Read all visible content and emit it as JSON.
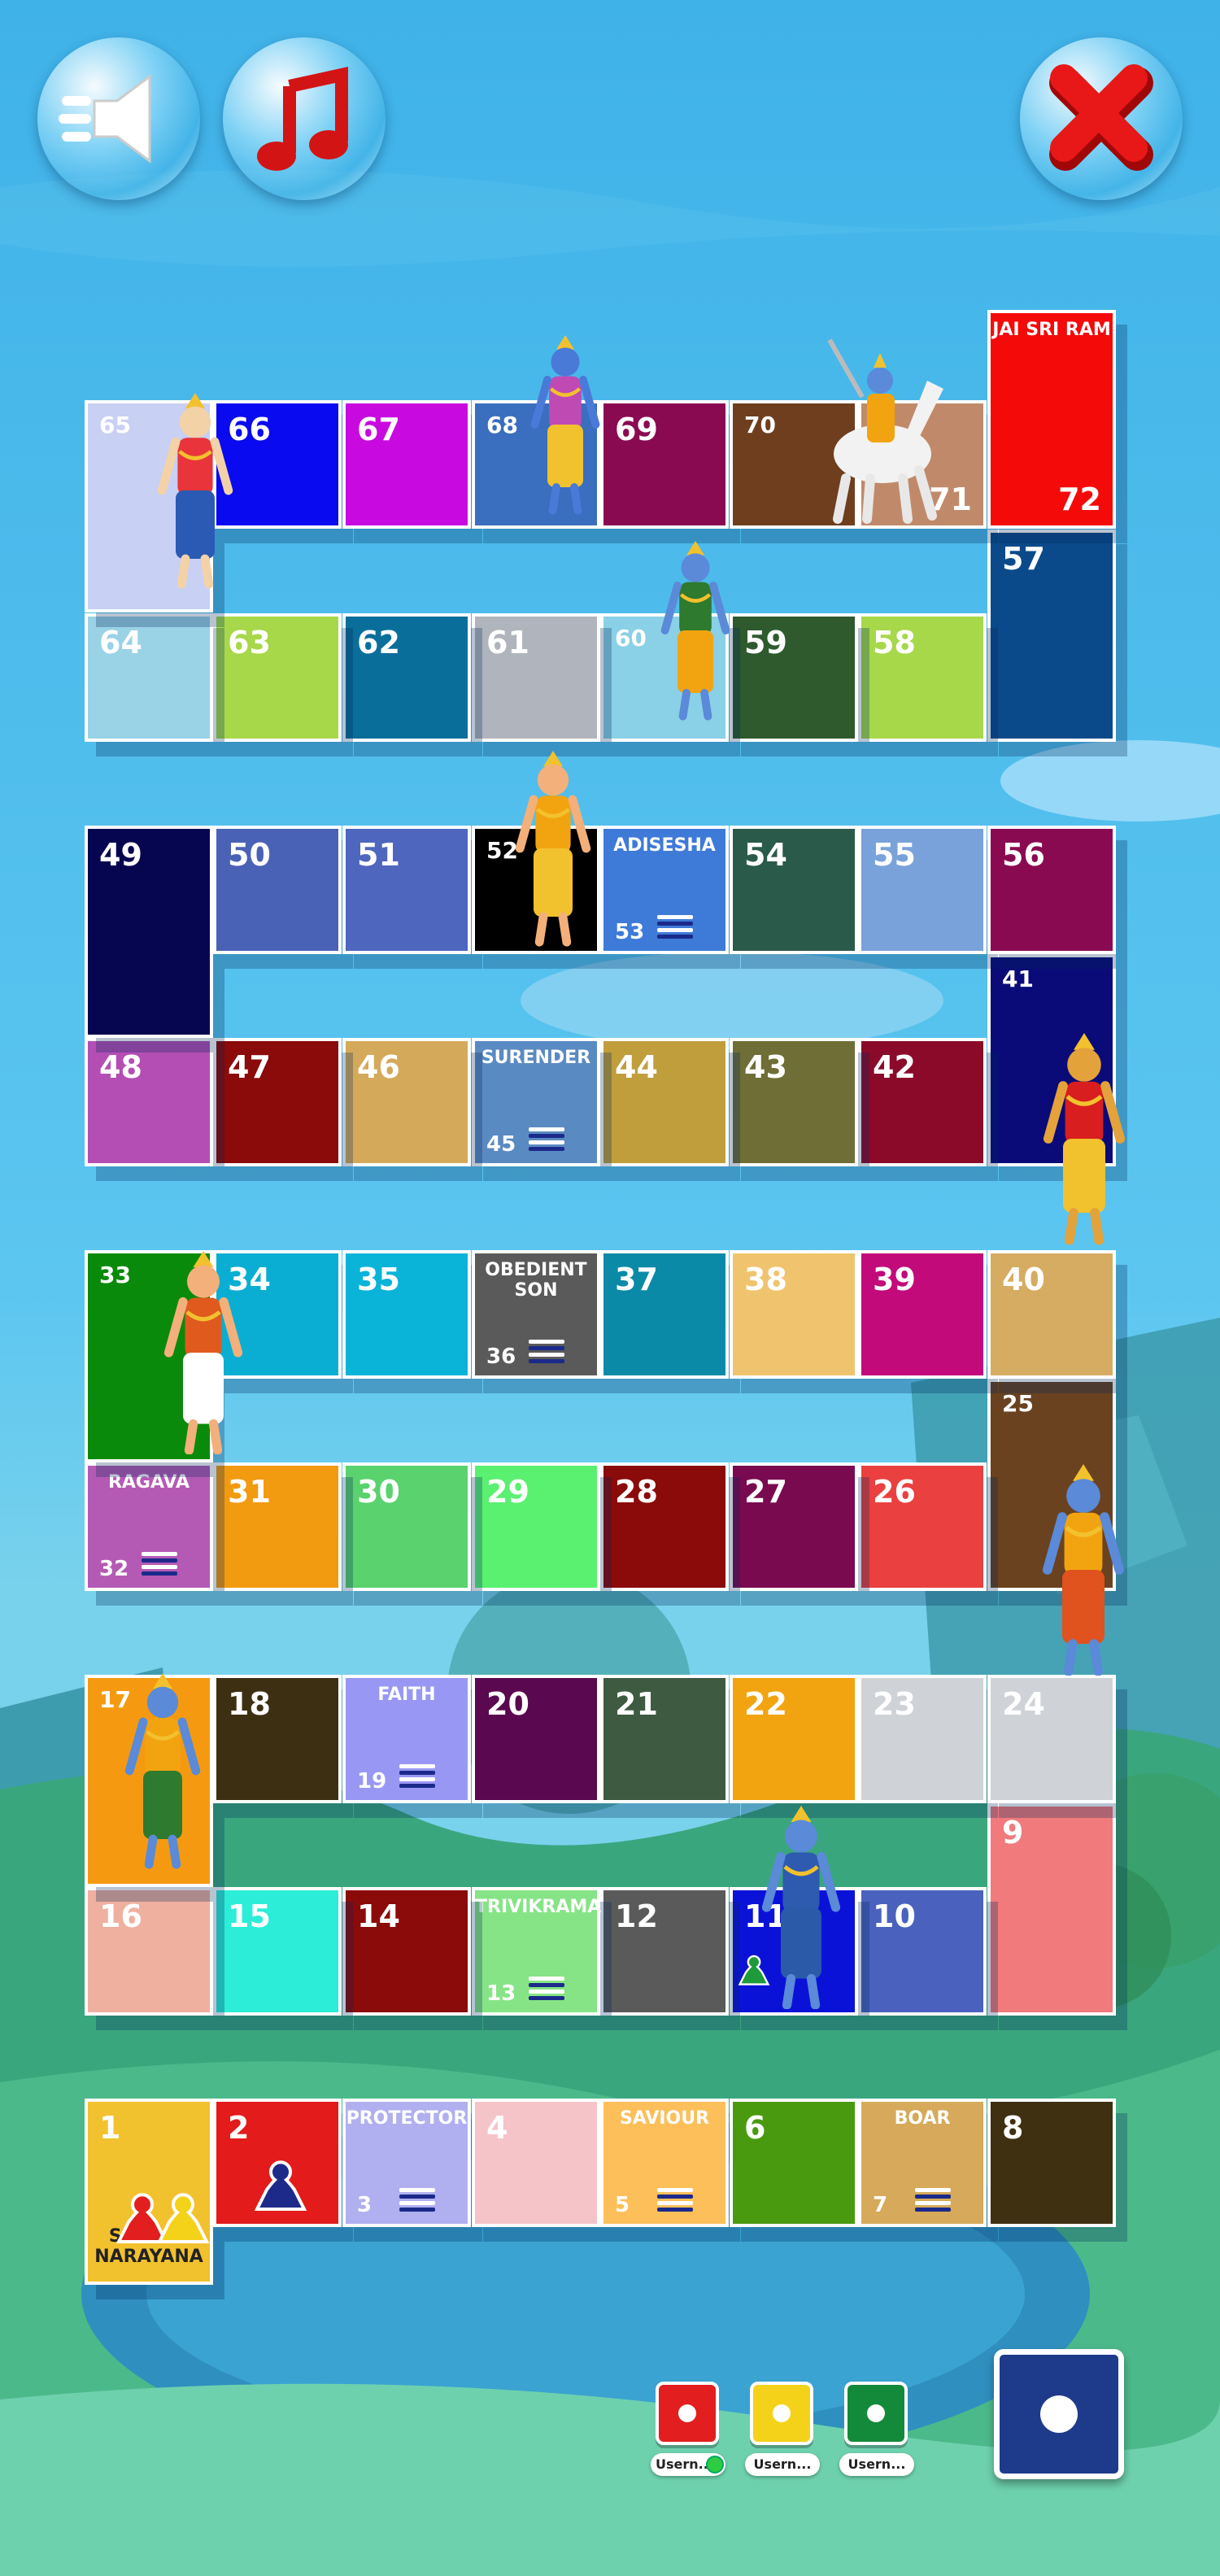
{
  "controls": {
    "sound_icon": "speaker-muted-icon",
    "music_icon": "music-note-icon",
    "close_icon": "close-x-icon"
  },
  "board": {
    "cells": [
      {
        "n": "1",
        "color": "#f2c12e",
        "title": "SRIMAN NARAYANA"
      },
      {
        "n": "2",
        "color": "#e31b1b"
      },
      {
        "n": "3",
        "color": "#b0b0f0",
        "title": "PROTECTOR",
        "ladder": true
      },
      {
        "n": "4",
        "color": "#f5c4c8"
      },
      {
        "n": "5",
        "color": "#fdbf5a",
        "title": "SAVIOUR",
        "ladder": true
      },
      {
        "n": "6",
        "color": "#4a9a10"
      },
      {
        "n": "7",
        "color": "#d6aa5a",
        "title": "BOAR",
        "ladder": true
      },
      {
        "n": "8",
        "color": "#3e3010"
      },
      {
        "n": "9",
        "color": "#f07a7c"
      },
      {
        "n": "10",
        "color": "#4a62be"
      },
      {
        "n": "11",
        "color": "#0b12d8"
      },
      {
        "n": "12",
        "color": "#5a5a5a"
      },
      {
        "n": "13",
        "color": "#86e486",
        "title": "TRIVIKRAMA",
        "ladder": true
      },
      {
        "n": "14",
        "color": "#8b0a0a"
      },
      {
        "n": "15",
        "color": "#2cedd8"
      },
      {
        "n": "16",
        "color": "#efb0a0"
      },
      {
        "n": "17",
        "color": "#f59a10"
      },
      {
        "n": "18",
        "color": "#3d2f12"
      },
      {
        "n": "19",
        "color": "#9898f4",
        "title": "FAITH",
        "ladder": true
      },
      {
        "n": "20",
        "color": "#5a0850"
      },
      {
        "n": "21",
        "color": "#3e5a40"
      },
      {
        "n": "22",
        "color": "#f2a410"
      },
      {
        "n": "23",
        "color": "#cfd2d6"
      },
      {
        "n": "24",
        "color": "#cfd2d6"
      },
      {
        "n": "25",
        "color": "#6a4220"
      },
      {
        "n": "26",
        "color": "#ea4040"
      },
      {
        "n": "27",
        "color": "#7a0a50"
      },
      {
        "n": "28",
        "color": "#8b0a0a"
      },
      {
        "n": "29",
        "color": "#5af070"
      },
      {
        "n": "30",
        "color": "#5ad26e"
      },
      {
        "n": "31",
        "color": "#f29a10"
      },
      {
        "n": "32",
        "color": "#b45ab4",
        "title": "RAGAVA",
        "ladder": true
      },
      {
        "n": "33",
        "color": "#0a8a0a"
      },
      {
        "n": "34",
        "color": "#0aaed2"
      },
      {
        "n": "35",
        "color": "#0ab4d8"
      },
      {
        "n": "36",
        "color": "#5a5a5a",
        "title": "OBEDIENT SON",
        "ladder": true
      },
      {
        "n": "37",
        "color": "#0a8aa6"
      },
      {
        "n": "38",
        "color": "#f0c46e"
      },
      {
        "n": "39",
        "color": "#c20a7a"
      },
      {
        "n": "40",
        "color": "#d6ac62"
      },
      {
        "n": "41",
        "color": "#0a0a78"
      },
      {
        "n": "42",
        "color": "#8b0a2a"
      },
      {
        "n": "43",
        "color": "#6e6e36"
      },
      {
        "n": "44",
        "color": "#c09e3c"
      },
      {
        "n": "45",
        "color": "#5a8ac2",
        "title": "SURENDER",
        "ladder": true
      },
      {
        "n": "46",
        "color": "#d4aa5a"
      },
      {
        "n": "47",
        "color": "#8b0a0a"
      },
      {
        "n": "48",
        "color": "#b44eb4"
      },
      {
        "n": "49",
        "color": "#060650"
      },
      {
        "n": "50",
        "color": "#4a62b6"
      },
      {
        "n": "51",
        "color": "#4e66be"
      },
      {
        "n": "52",
        "color": "#000000"
      },
      {
        "n": "53",
        "color": "#3e7ad8",
        "title": "ADISESHA",
        "ladder": true
      },
      {
        "n": "54",
        "color": "#2a5a4a"
      },
      {
        "n": "55",
        "color": "#7aa2da"
      },
      {
        "n": "56",
        "color": "#8a0a52"
      },
      {
        "n": "57",
        "color": "#0a4a8a"
      },
      {
        "n": "58",
        "color": "#a6d84a"
      },
      {
        "n": "59",
        "color": "#2e5a2e"
      },
      {
        "n": "60",
        "color": "#8ad0e6"
      },
      {
        "n": "61",
        "color": "#b0b4bc"
      },
      {
        "n": "62",
        "color": "#0a6e9a"
      },
      {
        "n": "63",
        "color": "#a6d84a"
      },
      {
        "n": "64",
        "color": "#9ad2e6"
      },
      {
        "n": "65",
        "color": "#c8d0f4"
      },
      {
        "n": "66",
        "color": "#0a0af0"
      },
      {
        "n": "67",
        "color": "#c80ae0"
      },
      {
        "n": "68",
        "color": "#3a6ebe"
      },
      {
        "n": "69",
        "color": "#8a0a52"
      },
      {
        "n": "70",
        "color": "#6e3e1e"
      },
      {
        "n": "71",
        "color": "#c08a6a"
      },
      {
        "n": "72",
        "color": "#f50a0a",
        "title": "JAI SRI RAM"
      }
    ],
    "deities": [
      "kurma-avatar",
      "matsya-avatar",
      "narasimha-avatar",
      "vamana-avatar",
      "hayagriva-avatar",
      "parashurama-avatar",
      "rama-avatar",
      "krishna-avatar",
      "balarama-avatar",
      "kalki-avatar"
    ]
  },
  "pawns": [
    {
      "cell": "1",
      "color": "#e21e1e",
      "name": "red-pawn"
    },
    {
      "cell": "1",
      "color": "#f4d21a",
      "name": "yellow-pawn"
    },
    {
      "cell": "2",
      "color": "#1e2a8a",
      "name": "blue-pawn"
    },
    {
      "cell": "11",
      "color": "#1e9a3a",
      "name": "green-pawn"
    }
  ],
  "players": [
    {
      "color": "#e21e1e",
      "label": "Usern...",
      "online": true
    },
    {
      "color": "#f4d21a",
      "label": "Usern...",
      "online": false
    },
    {
      "color": "#138a3a",
      "label": "Usern...",
      "online": false
    }
  ],
  "roll_button_color": "#1e3a8a"
}
